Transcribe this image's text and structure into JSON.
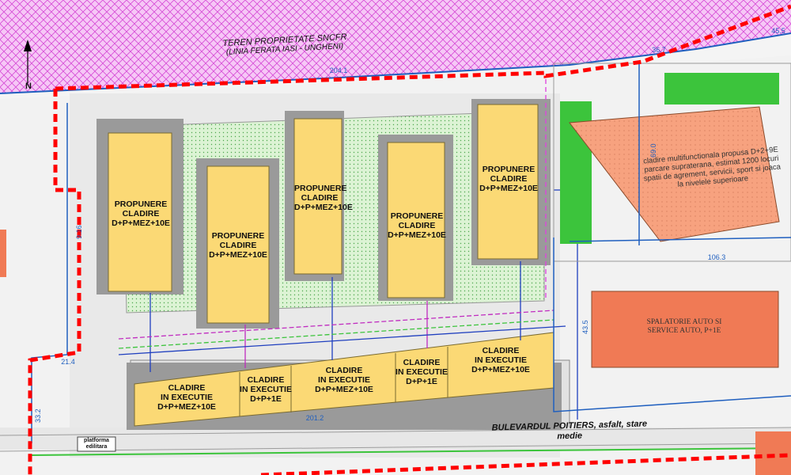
{
  "map": {
    "railway_title": "TEREN PROPRIETATE SNCFR",
    "railway_subtitle": "(LINIA FERATA IASI - UNGHENI)",
    "north_label": "N",
    "street_label": "BULEVARDUL POITIERS, asfalt, stare medie",
    "platform_label": "platforma\nedilitara",
    "buildings_proposed": [
      {
        "title": "PROPUNERE\nCLADIRE\nD+P+MEZ+10E"
      },
      {
        "title": "PROPUNERE\nCLADIRE\nD+P+MEZ+10E"
      },
      {
        "title": "PROPUNERE\nCLADIRE\nD+P+MEZ+10E"
      },
      {
        "title": "PROPUNERE\nCLADIRE\nD+P+MEZ+10E"
      },
      {
        "title": "PROPUNERE\nCLADIRE\nD+P+MEZ+10E"
      }
    ],
    "buildings_execution": [
      {
        "title": "CLADIRE\nIN EXECUTIE\nD+P+MEZ+10E"
      },
      {
        "title": "CLADIRE\nIN EXECUTIE\nD+P+1E"
      },
      {
        "title": "CLADIRE\nIN EXECUTIE\nD+P+MEZ+10E"
      },
      {
        "title": "CLADIRE\nIN EXECUTIE\nD+P+1E"
      },
      {
        "title": "CLADIRE\nIN EXECUTIE\nD+P+MEZ+10E"
      }
    ],
    "multifunctional": "cladire multifunctionala propusa D+2+9E\nparcare supraterana, estimat 1200 locuri\nspatii de agrement, servicii, sport si joaca\nla nivelele superioare",
    "carwash": "SPALATORIE AUTO SI\nSERVICE AUTO, P+1E",
    "dimensions": {
      "d1": "204.1",
      "d2": "36.7",
      "d3": "45.5",
      "d4": "106.3",
      "d5": "201.2",
      "d6": "21.4",
      "d7": "9.16",
      "d8": "43.5",
      "d9": "33.2",
      "d10": "69.0"
    },
    "colors": {
      "railway_hatch": "#e040e0",
      "proposed_building": "#fbd975",
      "green_area": "#d9f5d0",
      "orange_building": "#f59a74",
      "boundary_red": "#ff0000",
      "boundary_blue": "#1f5fbf"
    }
  }
}
